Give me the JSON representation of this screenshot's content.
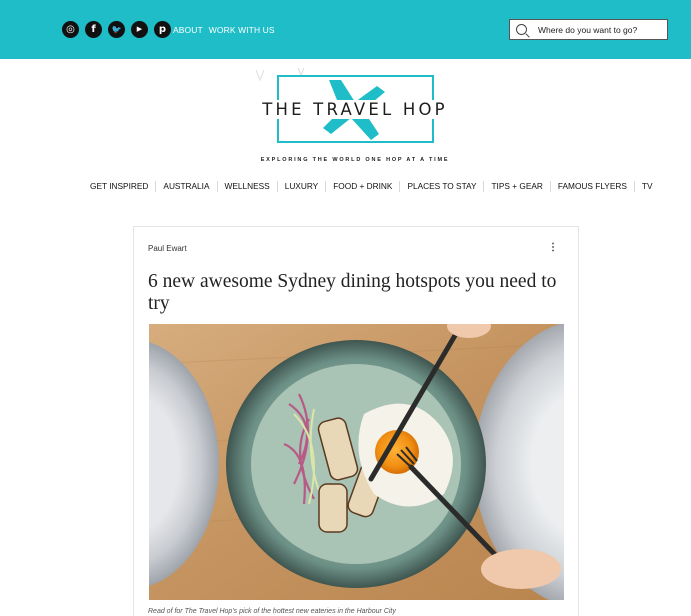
{
  "topbar": {
    "bg_color": "#1ebdc7",
    "social_icons": [
      {
        "name": "instagram-icon",
        "glyph": "◎"
      },
      {
        "name": "facebook-icon",
        "glyph": "f"
      },
      {
        "name": "twitter-icon",
        "glyph": "🐦"
      },
      {
        "name": "youtube-icon",
        "glyph": "▶"
      },
      {
        "name": "pinterest-icon",
        "glyph": "p"
      }
    ],
    "links": [
      "ABOUT",
      "WORK WITH US"
    ],
    "search_placeholder": "Where do you want to go?"
  },
  "logo": {
    "title": "THE TRAVEL HOP",
    "tagline": "EXPLORING THE WORLD ONE HOP AT A TIME",
    "accent": "#1ebdc7"
  },
  "nav": {
    "items": [
      "GET INSPIRED",
      "AUSTRALIA",
      "WELLNESS",
      "LUXURY",
      "FOOD + DRINK",
      "PLACES TO STAY",
      "TIPS + GEAR",
      "FAMOUS FLYERS",
      "TV"
    ]
  },
  "post": {
    "author": "Paul Ewart",
    "more_glyph": "⋮",
    "title": "6 new awesome Sydney dining hotspots you need to try",
    "caption": "Read of for The Travel Hop's pick of the hottest new eateries in the Harbour City"
  }
}
